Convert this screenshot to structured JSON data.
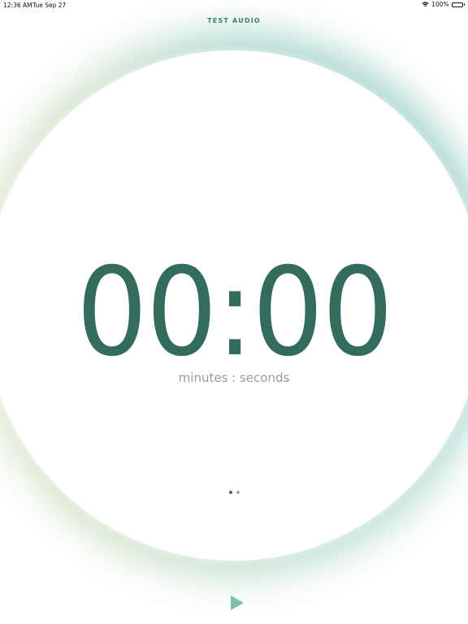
{
  "status_bar": {
    "time": "12:36 AM",
    "date": "Tue Sep 27",
    "battery": "100%"
  },
  "header": {
    "test_audio_label": "TEST AUDIO"
  },
  "timer": {
    "display": "00:00",
    "caption": "minutes : seconds"
  },
  "pager": {
    "pages": 2,
    "active_index": 0
  },
  "icons": {
    "play": "play-icon",
    "wifi": "wifi-icon",
    "battery": "battery-icon"
  },
  "colors": {
    "accent": "#346b5f",
    "caption": "#9a9a9a",
    "play": "#7bbfaf"
  }
}
